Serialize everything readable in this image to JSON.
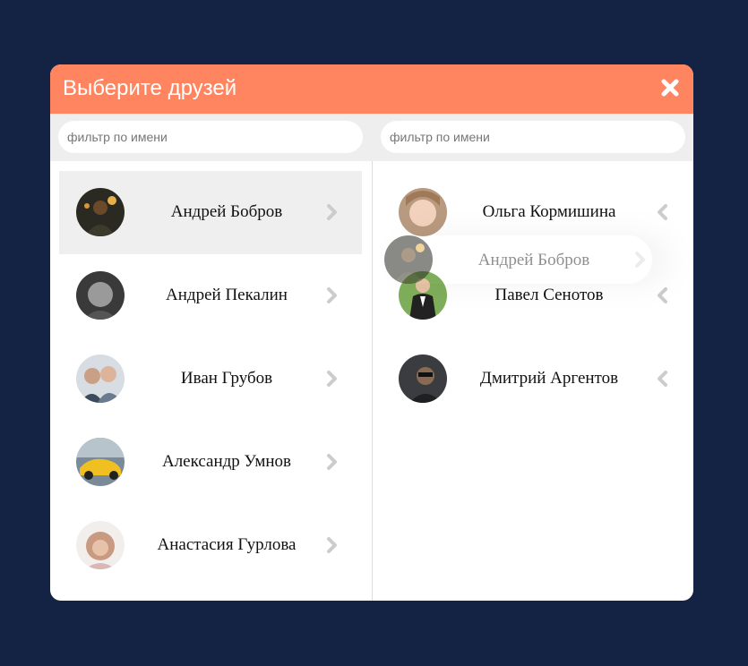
{
  "dialog": {
    "title": "Выберите друзей",
    "close_icon": "close-icon",
    "header_color": "#ff8560",
    "background_color": "#142244"
  },
  "filters": {
    "left_placeholder": "фильтр по имени",
    "right_placeholder": "фильтр по имени"
  },
  "available_friends": [
    {
      "name": "Андрей Бобров",
      "selected": true
    },
    {
      "name": "Андрей Пекалин",
      "selected": false
    },
    {
      "name": "Иван Грубов",
      "selected": false
    },
    {
      "name": "Александр Умнов",
      "selected": false
    },
    {
      "name": "Анастасия Гурлова",
      "selected": false
    }
  ],
  "chosen_friends": [
    {
      "name": "Ольга Кормишина"
    },
    {
      "name": "Павел Сенотов"
    },
    {
      "name": "Дмитрий Аргентов"
    }
  ],
  "dragging": {
    "name": "Андрей Бобров"
  }
}
